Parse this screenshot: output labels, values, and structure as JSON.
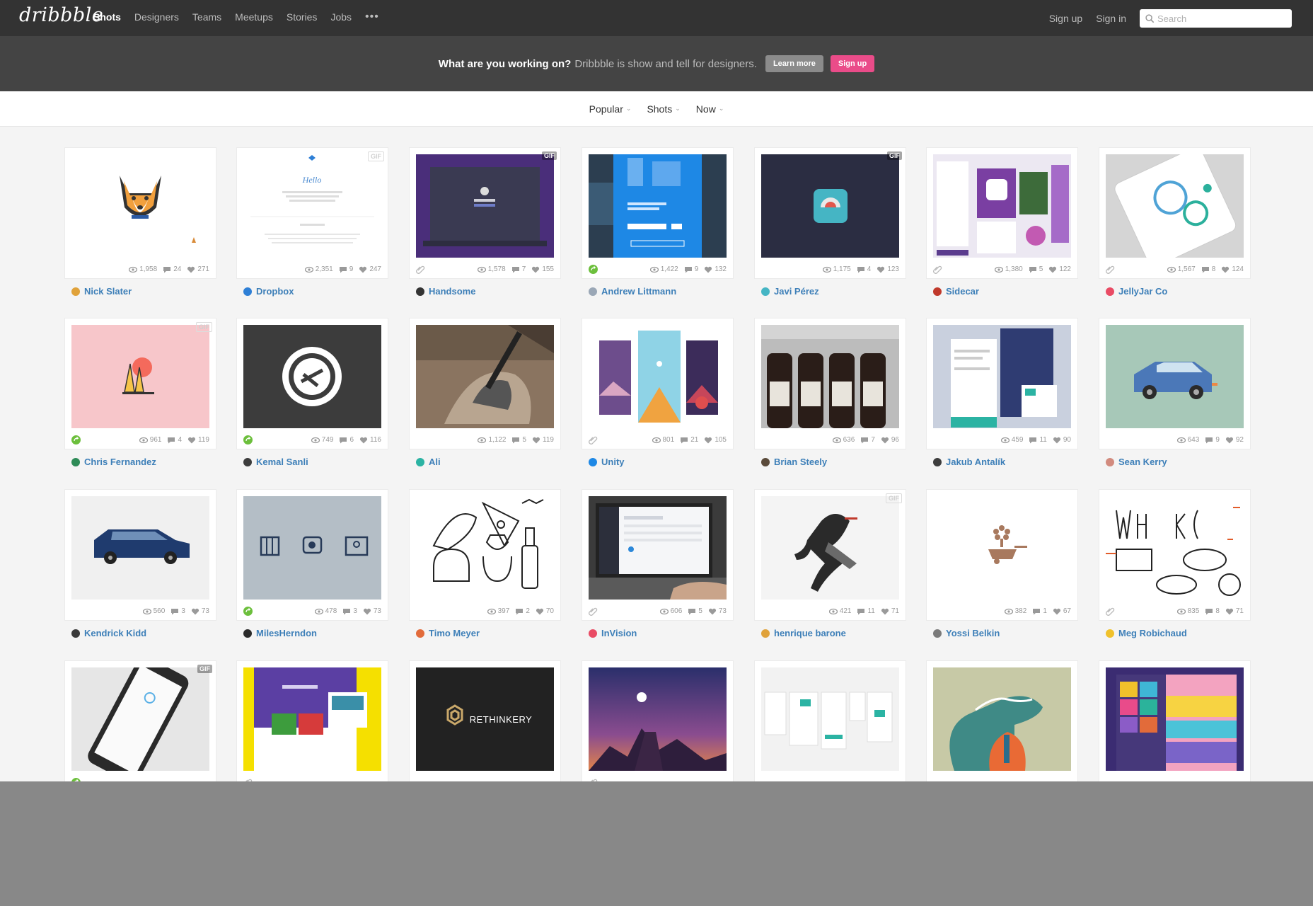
{
  "nav": {
    "logo": "dribbble",
    "links": [
      "Shots",
      "Designers",
      "Teams",
      "Meetups",
      "Stories",
      "Jobs"
    ],
    "active": "Shots",
    "more_icon": "more-dots-icon",
    "signup": "Sign up",
    "signin": "Sign in",
    "search_placeholder": "Search"
  },
  "banner": {
    "strong": "What are you working on?",
    "text": "Dribbble is show and tell for designers.",
    "learn_more": "Learn more",
    "signup": "Sign up"
  },
  "filters": [
    "Popular",
    "Shots",
    "Now"
  ],
  "colors": {
    "accent": "#ea4c89",
    "link": "#3d7fb8",
    "nav": "#333333",
    "banner": "#444444"
  },
  "shots": [
    {
      "author": "Nick Slater",
      "views": "1,958",
      "comments": "24",
      "likes": "271"
    },
    {
      "author": "Dropbox",
      "views": "2,351",
      "comments": "9",
      "likes": "247",
      "gif": "GIF"
    },
    {
      "author": "Handsome",
      "views": "1,578",
      "comments": "7",
      "likes": "155",
      "gif": "GIF"
    },
    {
      "author": "Andrew Littmann",
      "views": "1,422",
      "comments": "9",
      "likes": "132"
    },
    {
      "author": "Javi Pérez",
      "views": "1,175",
      "comments": "4",
      "likes": "123",
      "gif": "GIF"
    },
    {
      "author": "Sidecar",
      "views": "1,380",
      "comments": "5",
      "likes": "122"
    },
    {
      "author": "JellyJar Co",
      "views": "1,567",
      "comments": "8",
      "likes": "124"
    },
    {
      "author": "Chris Fernandez",
      "views": "961",
      "comments": "4",
      "likes": "119",
      "gif": "GIF"
    },
    {
      "author": "Kemal Sanli",
      "views": "749",
      "comments": "6",
      "likes": "116"
    },
    {
      "author": "Ali",
      "views": "1,122",
      "comments": "5",
      "likes": "119"
    },
    {
      "author": "Unity",
      "views": "801",
      "comments": "21",
      "likes": "105"
    },
    {
      "author": "Brian Steely",
      "views": "636",
      "comments": "7",
      "likes": "96"
    },
    {
      "author": "Jakub Antalík",
      "views": "459",
      "comments": "11",
      "likes": "90"
    },
    {
      "author": "Sean Kerry",
      "views": "643",
      "comments": "9",
      "likes": "92"
    },
    {
      "author": "Kendrick Kidd",
      "views": "560",
      "comments": "3",
      "likes": "73"
    },
    {
      "author": "MilesHerndon",
      "views": "478",
      "comments": "3",
      "likes": "73"
    },
    {
      "author": "Timo Meyer",
      "views": "397",
      "comments": "2",
      "likes": "70"
    },
    {
      "author": "InVision",
      "views": "606",
      "comments": "5",
      "likes": "73"
    },
    {
      "author": "henrique barone",
      "views": "421",
      "comments": "11",
      "likes": "71",
      "gif": "GIF"
    },
    {
      "author": "Yossi Belkin",
      "views": "382",
      "comments": "1",
      "likes": "67"
    },
    {
      "author": "Meg Robichaud",
      "views": "835",
      "comments": "8",
      "likes": "71"
    },
    {
      "gif": "GIF"
    },
    {},
    {
      "thumb_text": "RETHINKERY"
    },
    {},
    {},
    {},
    {}
  ]
}
